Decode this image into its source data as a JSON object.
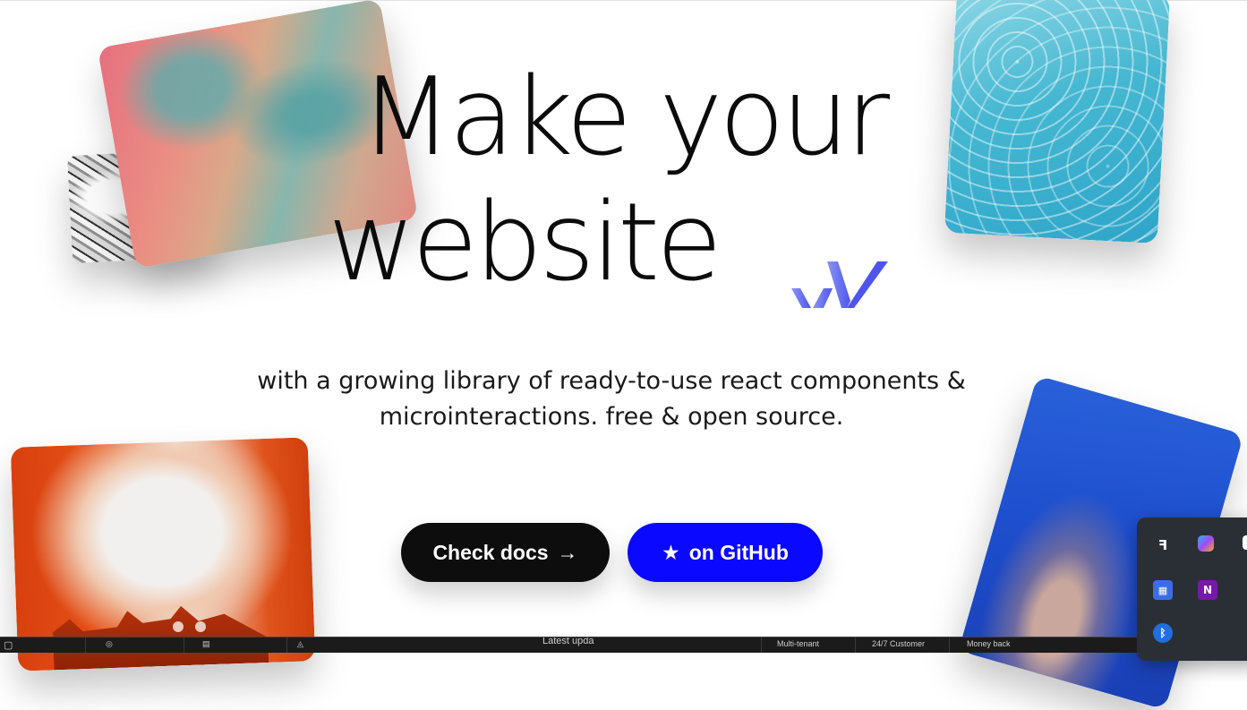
{
  "hero": {
    "headline_line1": "Make your",
    "headline_line2": "website",
    "subtitle_line1": "with a growing library of ready-to-use react components &",
    "subtitle_line2": "microinteractions. free & open source."
  },
  "buttons": {
    "docs_label": "Check docs",
    "docs_arrow": "→",
    "github_star": "★",
    "github_label": "on GitHub"
  },
  "colors": {
    "docs_button_bg": "#0d0d0d",
    "github_button_bg": "#0a08ff",
    "logo_accent": "#4f55ec"
  },
  "tray": {
    "icons": [
      "figma-icon",
      "copilot-icon",
      "taskbar-app-icon",
      "teams-tasks-icon",
      "onenote-icon",
      "vscode-icon",
      "bluetooth-icon"
    ]
  },
  "bottom_bar": {
    "items": [
      "Latest upda",
      "Multi-tenant",
      "24/7 Customer",
      "Money back"
    ]
  }
}
